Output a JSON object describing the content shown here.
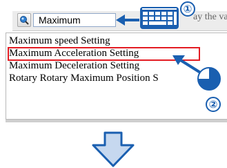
{
  "search": {
    "value": "Maximum",
    "hint_text": "ay the va"
  },
  "steps": {
    "one": "①",
    "two": "②"
  },
  "list": {
    "items": [
      {
        "label": "Maximum speed Setting"
      },
      {
        "label": "Maximum Acceleration Setting",
        "highlighted": true
      },
      {
        "label": "Maximum Deceleration Setting"
      },
      {
        "label": "Rotary Rotary Maximum Position S"
      }
    ]
  },
  "colors": {
    "arrow_blue": "#1a5fb0",
    "highlight_red": "#e31c23",
    "down_arrow_fill": "#c6d8ef"
  },
  "icons": {
    "search": "search-icon",
    "keyboard": "keyboard-icon",
    "pointer": "arrow-left-icon",
    "touch": "touch-icon",
    "next": "arrow-down-icon"
  }
}
